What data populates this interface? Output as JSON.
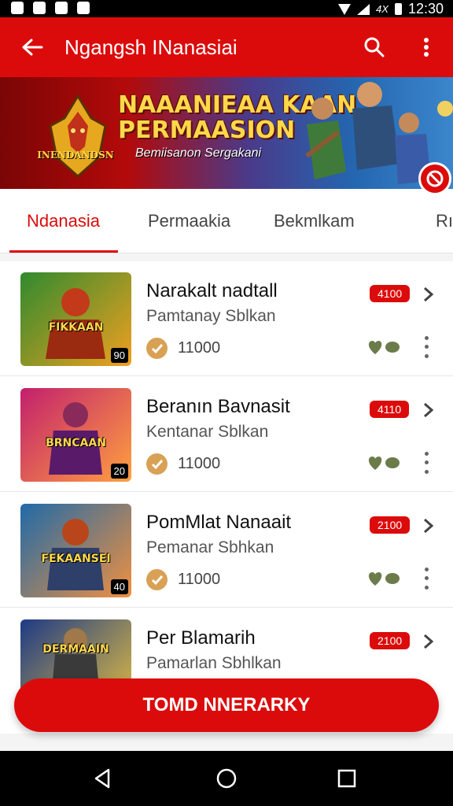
{
  "status_bar": {
    "network": "4X",
    "time": "12:30"
  },
  "app_bar": {
    "title": "Ngangsh INanasiai",
    "icons": [
      "back-arrow-icon",
      "search-icon",
      "more-vert-icon"
    ]
  },
  "banner": {
    "title_line1": "NAAANIEAA KAAN",
    "title_line2": "PERMAASION",
    "subtitle": "Bemiisanon Sergakani",
    "logo_text": "INENDANDSN"
  },
  "tabs": [
    {
      "label": "Ndanasia",
      "active": true
    },
    {
      "label": "Permaakia",
      "active": false
    },
    {
      "label": "Bekmlkam",
      "active": false
    },
    {
      "label": "Rı",
      "active": false
    }
  ],
  "items": [
    {
      "title": "Narakalt nadtall",
      "subtitle": "Pamtanay Sblkan",
      "count": "11000",
      "badge": "4100",
      "thumb_caption": "FIKKAAN",
      "thumb_label": "90",
      "thumb_colors": [
        "#2f8a2e",
        "#f0a020"
      ]
    },
    {
      "title": "Beranın Bavnasit",
      "subtitle": "Kentanar Sblkan",
      "count": "11000",
      "badge": "4110",
      "thumb_caption": "BRNCAAN",
      "thumb_label": "20",
      "thumb_colors": [
        "#c2206c",
        "#ffa040"
      ]
    },
    {
      "title": "PomMlat Nanaait",
      "subtitle": "Pemanar Sbhkan",
      "count": "11000",
      "badge": "2100",
      "thumb_caption": "FEKAANSEI",
      "thumb_label": "40",
      "thumb_colors": [
        "#1f6aa8",
        "#f09040"
      ]
    },
    {
      "title": "Per Blamarih",
      "subtitle": "Pamarlan Sbhlkan",
      "badge": "2100",
      "thumb_caption": "DERMAAIN",
      "thumb_colors": [
        "#1d3a86",
        "#e6c040"
      ]
    }
  ],
  "cta": {
    "label": "TOMD NNERARKY"
  },
  "colors": {
    "accent": "#dc0b0b",
    "check": "#d9a155",
    "heart": "#6b7b4a"
  }
}
